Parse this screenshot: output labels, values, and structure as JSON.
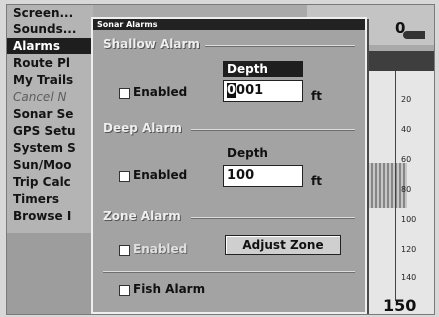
{
  "background_menu": {
    "items": [
      {
        "label": "Screen..."
      },
      {
        "label": "Sounds..."
      },
      {
        "label": "Alarms"
      },
      {
        "label": "Route Pl"
      },
      {
        "label": "My Trails"
      },
      {
        "label": "Cancel N"
      },
      {
        "label": "Sonar Se"
      },
      {
        "label": "GPS Setu"
      },
      {
        "label": "System S"
      },
      {
        "label": "Sun/Moo"
      },
      {
        "label": "Trip Calc"
      },
      {
        "label": "Timers"
      },
      {
        "label": "Browse I"
      }
    ],
    "selected": "Alarms"
  },
  "sonar": {
    "depth_label": "0",
    "scale_ticks": [
      "20",
      "40",
      "60",
      "80",
      "100",
      "120",
      "140"
    ],
    "scale_max": "150"
  },
  "dialog": {
    "title": "Sonar Alarms",
    "shallow": {
      "title": "Shallow Alarm",
      "enabled_label": "Enabled",
      "depth_header": "Depth",
      "cursor_digit": "0",
      "value_rest": "001",
      "unit": "ft"
    },
    "deep": {
      "title": "Deep Alarm",
      "enabled_label": "Enabled",
      "depth_header": "Depth",
      "value": "100",
      "unit": "ft"
    },
    "zone": {
      "title": "Zone Alarm",
      "enabled_label": "Enabled",
      "adjust_button": "Adjust Zone"
    },
    "fish": {
      "label": "Fish Alarm"
    }
  }
}
